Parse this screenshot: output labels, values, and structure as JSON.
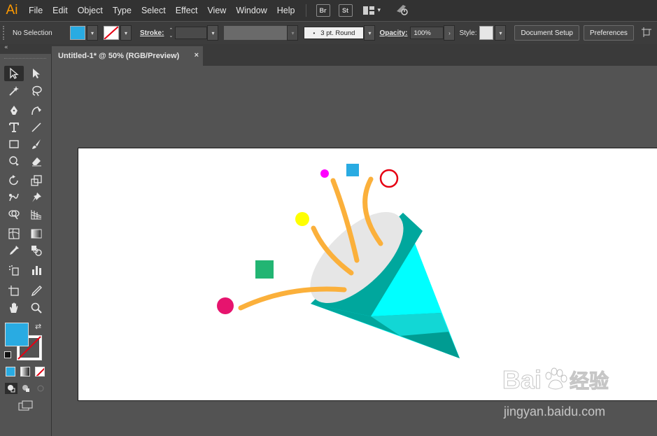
{
  "app": {
    "logo": "Ai"
  },
  "menu": {
    "items": [
      "File",
      "Edit",
      "Object",
      "Type",
      "Select",
      "Effect",
      "View",
      "Window",
      "Help"
    ]
  },
  "menu_icons": {
    "bridge": "Br",
    "stock": "St"
  },
  "control": {
    "selection_label": "No Selection",
    "fill_color": "#29abe2",
    "stroke_label": "Stroke:",
    "brush_label": "3 pt. Round",
    "opacity_label": "Opacity:",
    "opacity_value": "100%",
    "style_label": "Style:",
    "doc_setup": "Document Setup",
    "preferences": "Preferences"
  },
  "document": {
    "tab_title": "Untitled-1* @ 50% (RGB/Preview)",
    "close": "×"
  },
  "colors": {
    "cone_light": "#00ffff",
    "cone_dark": "#00a79d",
    "streamer": "#fbb03b",
    "dot_magenta": "#ff00ff",
    "dot_pink": "#e6146e",
    "dot_yellow": "#ffff00",
    "square_blue": "#29abe2",
    "square_green": "#22b573",
    "ring_red": "#e60012",
    "cone_top": "#e6e6e6"
  },
  "watermark": {
    "brand": "Bai",
    "brand2": "经验",
    "url": "jingyan.baidu.com"
  }
}
